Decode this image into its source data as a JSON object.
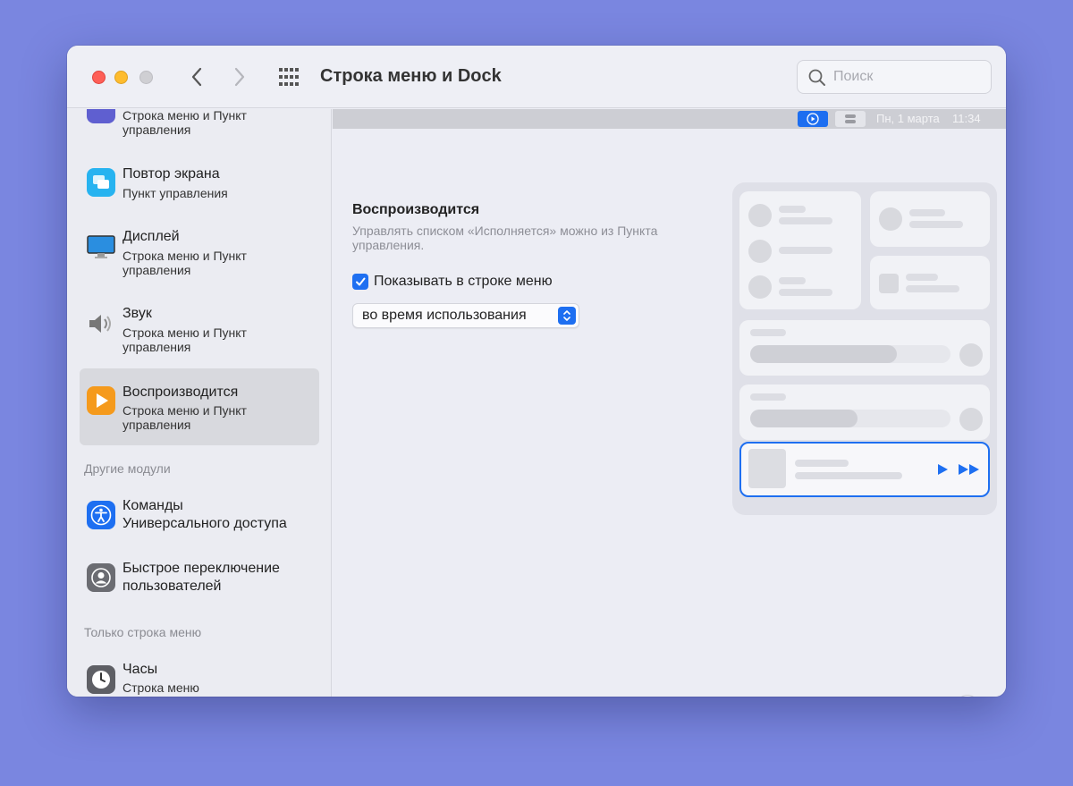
{
  "window": {
    "title": "Строка меню и Dock"
  },
  "search": {
    "placeholder": "Поиск"
  },
  "sidebar": {
    "items": [
      {
        "title": "",
        "subtitle": "Строка меню и Пункт управления",
        "icon": "partial-icon"
      },
      {
        "title": "Повтор экрана",
        "subtitle": "Пункт управления",
        "icon": "screen-mirroring-icon"
      },
      {
        "title": "Дисплей",
        "subtitle": "Строка меню и Пункт управления",
        "icon": "display-icon"
      },
      {
        "title": "Звук",
        "subtitle": "Строка меню и Пункт управления",
        "icon": "speaker-icon"
      },
      {
        "title": "Воспроизводится",
        "subtitle": "Строка меню и Пункт управления",
        "icon": "now-playing-icon",
        "selected": true
      }
    ],
    "section_other": "Другие модули",
    "other_items": [
      {
        "title": "Команды\nУниверсального доступа",
        "title_line1": "Команды",
        "title_line2": "Универсального доступа",
        "icon": "accessibility-icon"
      },
      {
        "title_line1": "Быстрое переключение",
        "title_line2": "пользователей",
        "icon": "fast-user-switching-icon"
      }
    ],
    "section_menubar_only": "Только строка меню",
    "menubar_items": [
      {
        "title": "Часы",
        "subtitle": "Строка меню",
        "icon": "clock-icon"
      }
    ]
  },
  "preview": {
    "date": "Пн, 1 марта",
    "time": "11:34"
  },
  "settings": {
    "section_title": "Воспроизводится",
    "description": "Управлять списком «Исполняется» можно из Пункта управления.",
    "show_in_menubar_label": "Показывать в строке меню",
    "show_in_menubar_checked": true,
    "mode_value": "во время использования"
  },
  "help": {
    "label": "?"
  },
  "colors": {
    "accent": "#1e6ff1",
    "background": "#7a86e0",
    "now_playing_orange": "#f59a1c"
  }
}
